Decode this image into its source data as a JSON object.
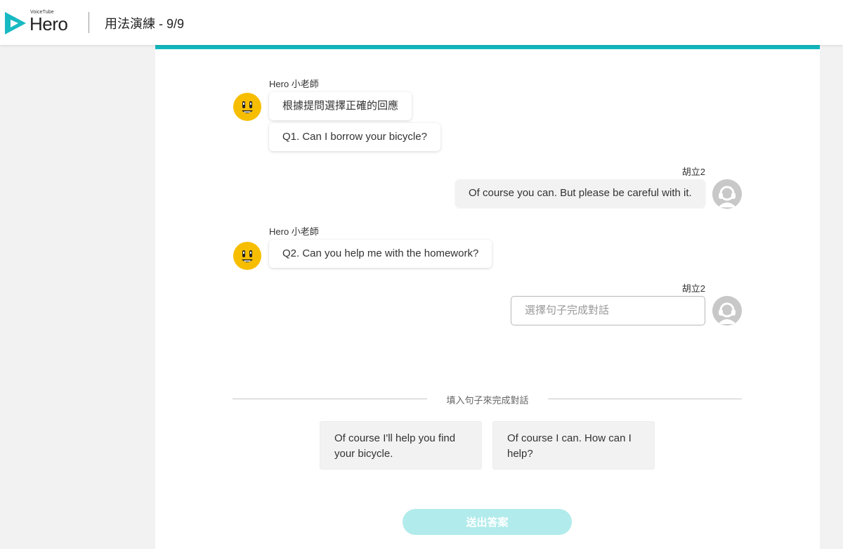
{
  "header": {
    "logo_small": "VoiceTube",
    "logo_word": "Hero",
    "title": "用法演練 - 9/9"
  },
  "conversation": {
    "bot_name": "Hero 小老師",
    "user_name": "胡立2",
    "bot_turn_1": {
      "instruction": "根據提問選擇正確的回應",
      "question": "Q1. Can I borrow your bicycle?"
    },
    "user_turn_1": {
      "reply": "Of course you can. But please be careful with it."
    },
    "bot_turn_2": {
      "question": "Q2. Can you help me with the homework?"
    },
    "user_turn_2": {
      "placeholder": "選擇句子完成對話"
    }
  },
  "options": {
    "hint": "填入句子來完成對話",
    "items": [
      "Of course I'll help you find your bicycle.",
      "Of course I can. How can I help?"
    ]
  },
  "submit": {
    "label": "送出答案"
  },
  "colors": {
    "accent": "#12b8bd",
    "submit_disabled": "#b2ebeb",
    "bot_avatar": "#f7be00",
    "page_bg": "#f2f2f2"
  }
}
